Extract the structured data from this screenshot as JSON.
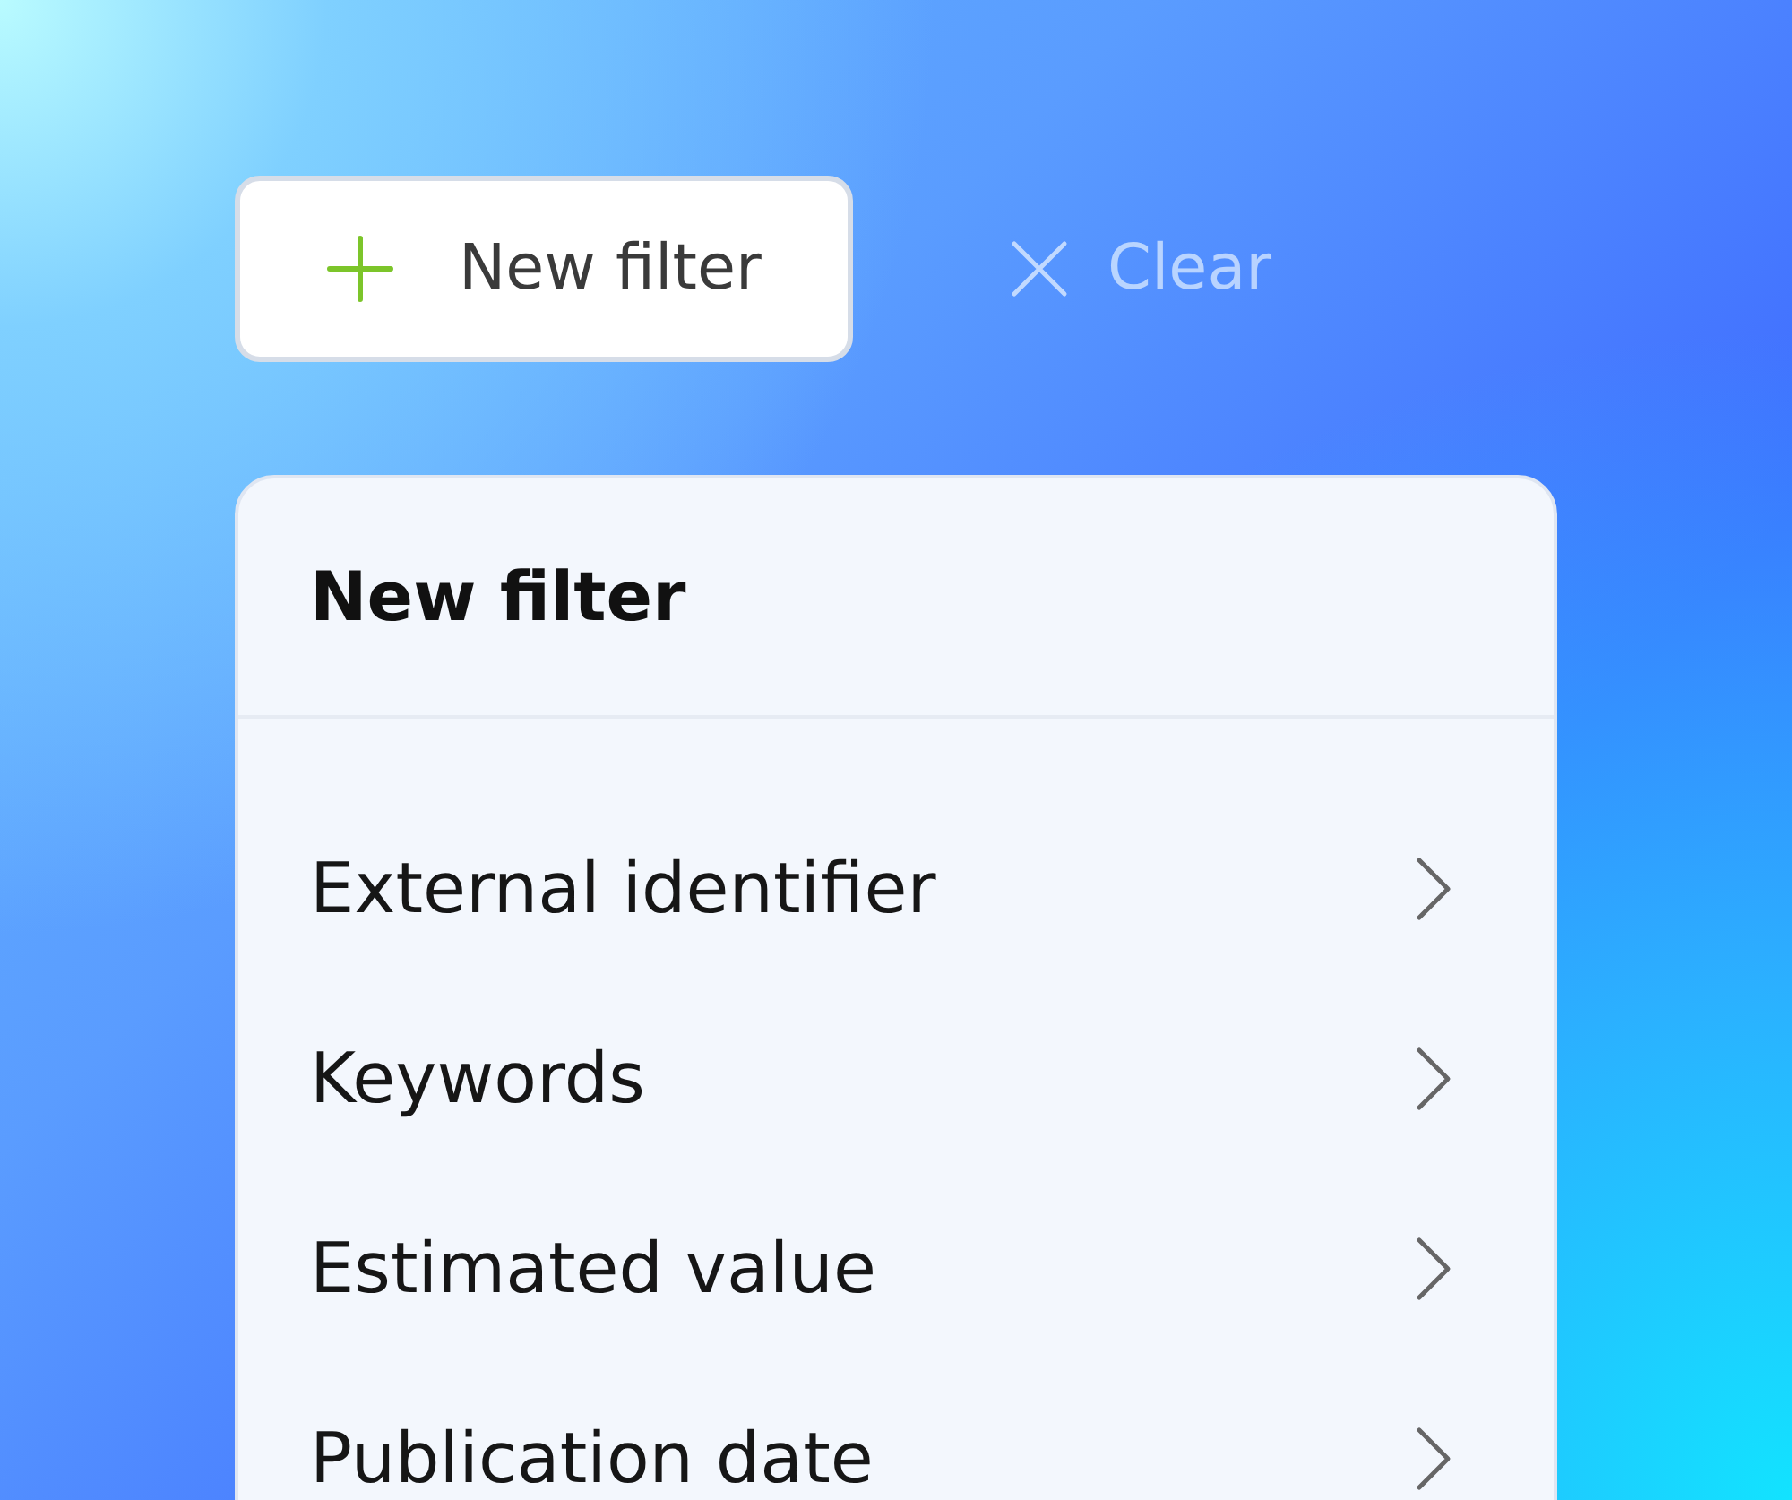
{
  "toolbar": {
    "new_filter_button": {
      "label": "New filter"
    },
    "clear_button": {
      "label": "Clear"
    }
  },
  "menu": {
    "title": "New filter",
    "items": [
      {
        "label": "External identifier"
      },
      {
        "label": "Keywords"
      },
      {
        "label": "Estimated value"
      },
      {
        "label": "Publication date"
      }
    ]
  }
}
